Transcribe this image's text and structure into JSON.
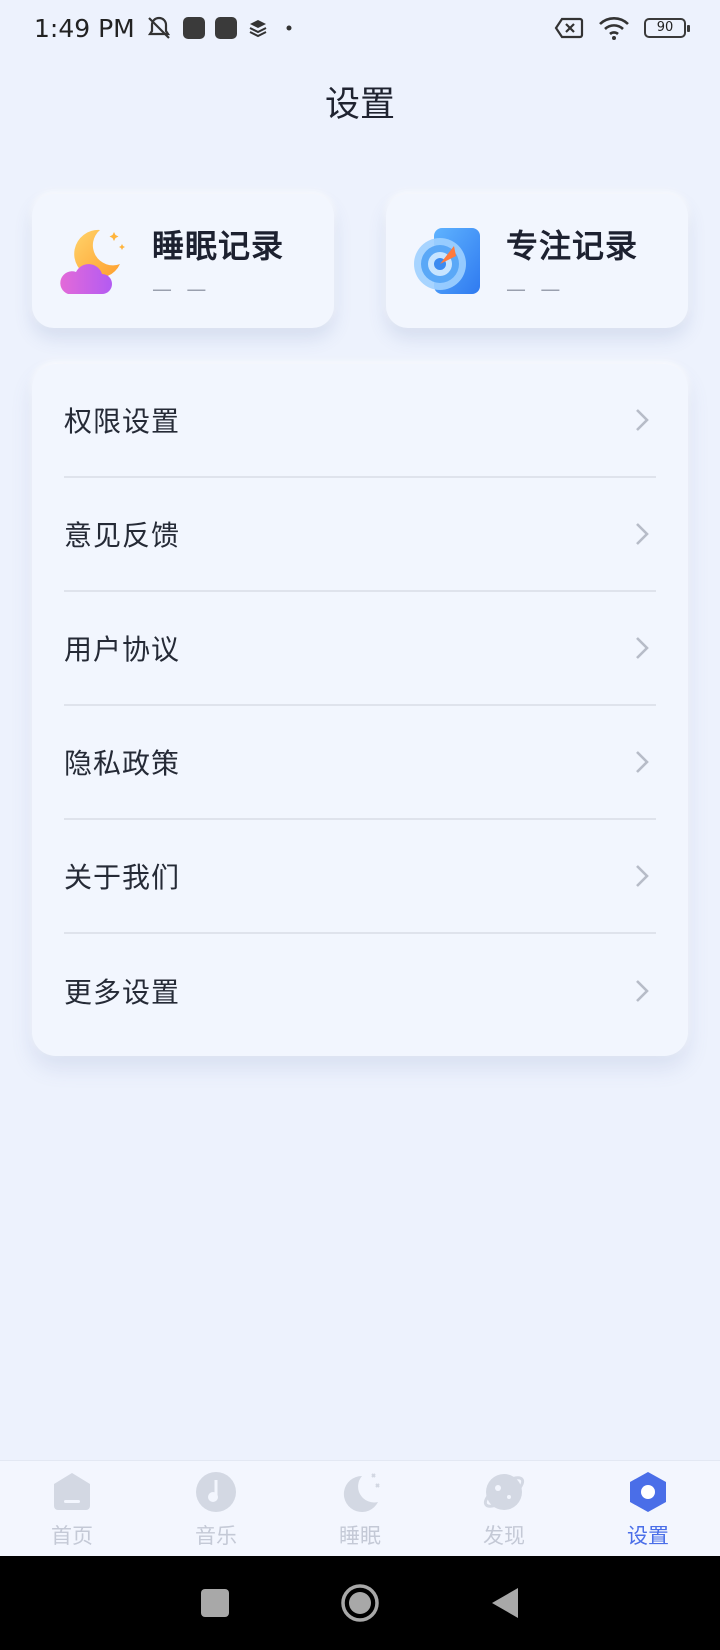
{
  "status_bar": {
    "time": "1:49 PM",
    "icons": [
      "muted-bell-icon",
      "app-notification-icon",
      "app-notification-icon",
      "layers-icon",
      "dot-icon",
      "no-sim-icon",
      "wifi-icon"
    ],
    "battery": "90"
  },
  "header": {
    "title": "设置"
  },
  "cards": [
    {
      "title": "睡眠记录",
      "value": "— —",
      "icon": "moon-cloud-icon"
    },
    {
      "title": "专注记录",
      "value": "— —",
      "icon": "target-icon"
    }
  ],
  "settings": {
    "items": [
      {
        "label": "权限设置"
      },
      {
        "label": "意见反馈"
      },
      {
        "label": "用户协议"
      },
      {
        "label": "隐私政策"
      },
      {
        "label": "关于我们"
      },
      {
        "label": "更多设置"
      }
    ]
  },
  "bottom_nav": {
    "items": [
      {
        "label": "首页",
        "icon": "home-icon",
        "active": false
      },
      {
        "label": "音乐",
        "icon": "music-icon",
        "active": false
      },
      {
        "label": "睡眠",
        "icon": "sleep-moon-icon",
        "active": false
      },
      {
        "label": "发现",
        "icon": "planet-icon",
        "active": false
      },
      {
        "label": "设置",
        "icon": "settings-hexagon-icon",
        "active": true
      }
    ]
  },
  "colors": {
    "background": "#edf2fd",
    "card": "#f2f6fe",
    "accent": "#4a6ee8",
    "inactive": "#c4c9d6"
  }
}
